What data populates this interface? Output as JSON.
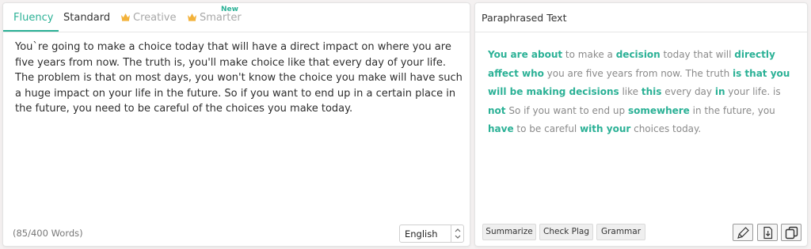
{
  "tabs": {
    "fluency": "Fluency",
    "standard": "Standard",
    "creative": "Creative",
    "smarter": "Smarter",
    "new_badge": "New"
  },
  "input": {
    "text": "You`re going to make a choice today that will have a direct impact on where you are five years from now. The truth is, you'll make choice like that every day of your life. The problem is that on most days, you won't know the choice you make will have such a huge impact on your life in the future. So if you want to end up in a certain place in the future, you need to be careful of the choices you make today.",
    "word_count": "(85/400 Words)",
    "language": "English"
  },
  "output": {
    "title": "Paraphrased Text",
    "segments": [
      {
        "text": "You are about",
        "hl": true
      },
      {
        "text": " to make a ",
        "hl": false
      },
      {
        "text": "decision",
        "hl": true
      },
      {
        "text": " today that will ",
        "hl": false
      },
      {
        "text": "directly affect who",
        "hl": true
      },
      {
        "text": " you are five years from now. The truth ",
        "hl": false
      },
      {
        "text": "is that you will be making decisions",
        "hl": true
      },
      {
        "text": " like ",
        "hl": false
      },
      {
        "text": "this",
        "hl": true
      },
      {
        "text": " every day ",
        "hl": false
      },
      {
        "text": "in",
        "hl": true
      },
      {
        "text": " your life. is ",
        "hl": false
      },
      {
        "text": "not",
        "hl": true
      },
      {
        "text": " So if you want to end up ",
        "hl": false
      },
      {
        "text": "somewhere",
        "hl": true
      },
      {
        "text": " in the future, you ",
        "hl": false
      },
      {
        "text": "have",
        "hl": true
      },
      {
        "text": " to be careful ",
        "hl": false
      },
      {
        "text": "with your",
        "hl": true
      },
      {
        "text": " choices today.",
        "hl": false
      }
    ]
  },
  "actions": {
    "summarize": "Summarize",
    "check_plag": "Check Plag",
    "grammar": "Grammar"
  },
  "icons": {
    "crown": "crown-icon",
    "edit": "highlighter-icon",
    "download": "download-icon",
    "copy": "copy-icon"
  },
  "colors": {
    "accent": "#2bb196",
    "crown": "#f3b23a"
  }
}
